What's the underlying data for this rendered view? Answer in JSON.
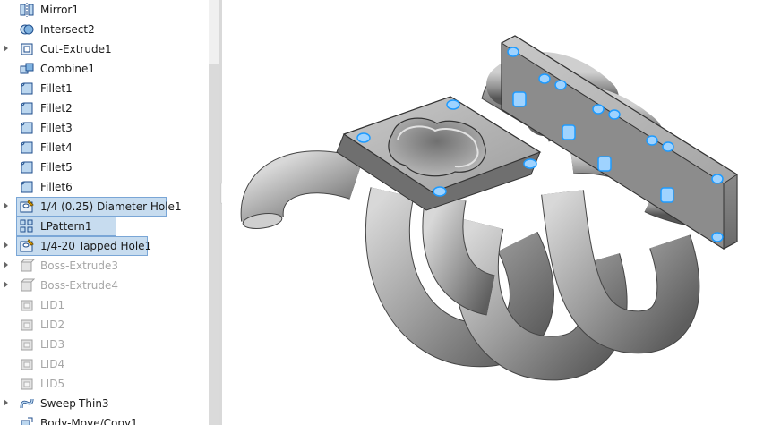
{
  "feature_tree": [
    {
      "label": "Mirror1",
      "icon": "mirror-icon",
      "expander": false,
      "suppressed": false,
      "selected": false
    },
    {
      "label": "Intersect2",
      "icon": "intersect-icon",
      "expander": false,
      "suppressed": false,
      "selected": false
    },
    {
      "label": "Cut-Extrude1",
      "icon": "cut-extrude-icon",
      "expander": true,
      "suppressed": false,
      "selected": false
    },
    {
      "label": "Combine1",
      "icon": "combine-icon",
      "expander": false,
      "suppressed": false,
      "selected": false
    },
    {
      "label": "Fillet1",
      "icon": "fillet-icon",
      "expander": false,
      "suppressed": false,
      "selected": false
    },
    {
      "label": "Fillet2",
      "icon": "fillet-icon",
      "expander": false,
      "suppressed": false,
      "selected": false
    },
    {
      "label": "Fillet3",
      "icon": "fillet-icon",
      "expander": false,
      "suppressed": false,
      "selected": false
    },
    {
      "label": "Fillet4",
      "icon": "fillet-icon",
      "expander": false,
      "suppressed": false,
      "selected": false
    },
    {
      "label": "Fillet5",
      "icon": "fillet-icon",
      "expander": false,
      "suppressed": false,
      "selected": false
    },
    {
      "label": "Fillet6",
      "icon": "fillet-icon",
      "expander": false,
      "suppressed": false,
      "selected": false
    },
    {
      "label": "1/4 (0.25) Diameter Hole1",
      "icon": "hole-wizard-icon",
      "expander": true,
      "suppressed": false,
      "selected": true
    },
    {
      "label": "LPattern1",
      "icon": "linear-pattern-icon",
      "expander": false,
      "suppressed": false,
      "selected": true
    },
    {
      "label": "1/4-20 Tapped Hole1",
      "icon": "hole-wizard-icon",
      "expander": true,
      "suppressed": false,
      "selected": true
    },
    {
      "label": "Boss-Extrude3",
      "icon": "boss-extrude-icon",
      "expander": true,
      "suppressed": true,
      "selected": false
    },
    {
      "label": "Boss-Extrude4",
      "icon": "boss-extrude-icon",
      "expander": true,
      "suppressed": true,
      "selected": false
    },
    {
      "label": "LID1",
      "icon": "body-icon",
      "expander": false,
      "suppressed": true,
      "selected": false
    },
    {
      "label": "LID2",
      "icon": "body-icon",
      "expander": false,
      "suppressed": true,
      "selected": false
    },
    {
      "label": "LID3",
      "icon": "body-icon",
      "expander": false,
      "suppressed": true,
      "selected": false
    },
    {
      "label": "LID4",
      "icon": "body-icon",
      "expander": false,
      "suppressed": true,
      "selected": false
    },
    {
      "label": "LID5",
      "icon": "body-icon",
      "expander": false,
      "suppressed": true,
      "selected": false
    },
    {
      "label": "Sweep-Thin3",
      "icon": "sweep-icon",
      "expander": true,
      "suppressed": false,
      "selected": false
    },
    {
      "label": "Body-Move/Copy1",
      "icon": "move-copy-icon",
      "expander": false,
      "suppressed": false,
      "selected": false
    }
  ],
  "colors": {
    "selection_fill": "#c7dcef",
    "selection_border": "#7aa6d6",
    "suppressed_text": "#a6a6a6",
    "hole_highlight": "#1e9bff",
    "model_gray": "#9a9a9a"
  }
}
